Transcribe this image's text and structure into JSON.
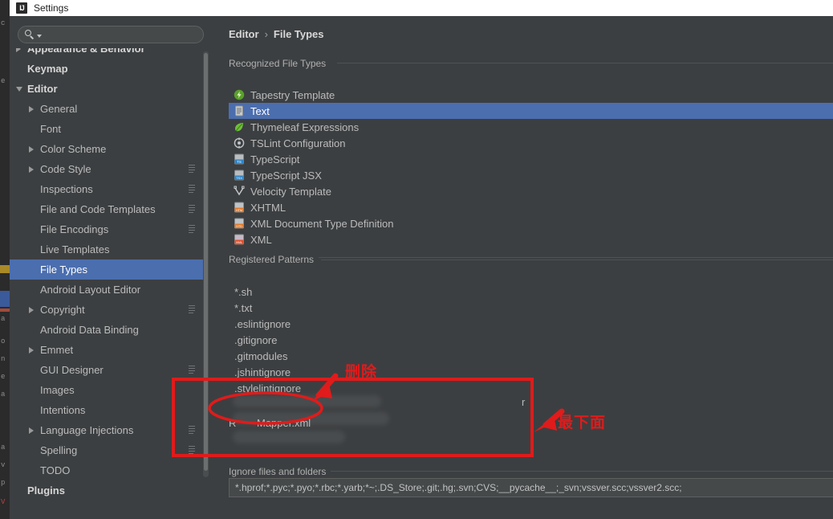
{
  "window": {
    "title": "Settings",
    "logo_icon": "intellij-idea-logo"
  },
  "search": {
    "placeholder": "",
    "value": "",
    "icon": "search-icon",
    "caret_icon": "chevron-down-icon"
  },
  "sidebar": {
    "items": [
      {
        "label": "Appearance & Behavior",
        "level": 0,
        "bold": true,
        "arrow": "right",
        "config_icon": false,
        "selected": false,
        "clipped": true
      },
      {
        "label": "Keymap",
        "level": 0,
        "bold": true,
        "arrow": "none",
        "config_icon": false,
        "selected": false
      },
      {
        "label": "Editor",
        "level": 0,
        "bold": true,
        "arrow": "down",
        "config_icon": false,
        "selected": false
      },
      {
        "label": "General",
        "level": 1,
        "bold": false,
        "arrow": "right",
        "config_icon": false,
        "selected": false
      },
      {
        "label": "Font",
        "level": 1,
        "bold": false,
        "arrow": "none",
        "config_icon": false,
        "selected": false
      },
      {
        "label": "Color Scheme",
        "level": 1,
        "bold": false,
        "arrow": "right",
        "config_icon": false,
        "selected": false
      },
      {
        "label": "Code Style",
        "level": 1,
        "bold": false,
        "arrow": "right",
        "config_icon": true,
        "selected": false
      },
      {
        "label": "Inspections",
        "level": 1,
        "bold": false,
        "arrow": "none",
        "config_icon": true,
        "selected": false
      },
      {
        "label": "File and Code Templates",
        "level": 1,
        "bold": false,
        "arrow": "none",
        "config_icon": true,
        "selected": false
      },
      {
        "label": "File Encodings",
        "level": 1,
        "bold": false,
        "arrow": "none",
        "config_icon": true,
        "selected": false
      },
      {
        "label": "Live Templates",
        "level": 1,
        "bold": false,
        "arrow": "none",
        "config_icon": false,
        "selected": false
      },
      {
        "label": "File Types",
        "level": 1,
        "bold": false,
        "arrow": "none",
        "config_icon": false,
        "selected": true
      },
      {
        "label": "Android Layout Editor",
        "level": 1,
        "bold": false,
        "arrow": "none",
        "config_icon": false,
        "selected": false
      },
      {
        "label": "Copyright",
        "level": 1,
        "bold": false,
        "arrow": "right",
        "config_icon": true,
        "selected": false
      },
      {
        "label": "Android Data Binding",
        "level": 1,
        "bold": false,
        "arrow": "none",
        "config_icon": false,
        "selected": false
      },
      {
        "label": "Emmet",
        "level": 1,
        "bold": false,
        "arrow": "right",
        "config_icon": false,
        "selected": false
      },
      {
        "label": "GUI Designer",
        "level": 1,
        "bold": false,
        "arrow": "none",
        "config_icon": true,
        "selected": false
      },
      {
        "label": "Images",
        "level": 1,
        "bold": false,
        "arrow": "none",
        "config_icon": false,
        "selected": false
      },
      {
        "label": "Intentions",
        "level": 1,
        "bold": false,
        "arrow": "none",
        "config_icon": false,
        "selected": false
      },
      {
        "label": "Language Injections",
        "level": 1,
        "bold": false,
        "arrow": "right",
        "config_icon": true,
        "selected": false
      },
      {
        "label": "Spelling",
        "level": 1,
        "bold": false,
        "arrow": "none",
        "config_icon": true,
        "selected": false
      },
      {
        "label": "TODO",
        "level": 1,
        "bold": false,
        "arrow": "none",
        "config_icon": false,
        "selected": false
      },
      {
        "label": "Plugins",
        "level": 0,
        "bold": true,
        "arrow": "none",
        "config_icon": false,
        "selected": false
      }
    ]
  },
  "breadcrumb": {
    "parent": "Editor",
    "separator": "›",
    "current": "File Types"
  },
  "main": {
    "recognized_label": "Recognized File Types",
    "registered_label": "Registered Patterns",
    "ignore_label": "Ignore files and folders",
    "ignore_value": "*.hprof;*.pyc;*.pyo;*.rbc;*.yarb;*~;.DS_Store;.git;.hg;.svn;CVS;__pycache__;_svn;vssver.scc;vssver2.scc;",
    "file_types": [
      {
        "label": "Tapestry Template",
        "icon": "tapestry-icon",
        "selected": false
      },
      {
        "label": "Text",
        "icon": "text-file-icon",
        "selected": true
      },
      {
        "label": "Thymeleaf Expressions",
        "icon": "thymeleaf-icon",
        "selected": false
      },
      {
        "label": "TSLint Configuration",
        "icon": "tslint-icon",
        "selected": false
      },
      {
        "label": "TypeScript",
        "icon": "typescript-icon",
        "selected": false
      },
      {
        "label": "TypeScript JSX",
        "icon": "typescript-jsx-icon",
        "selected": false
      },
      {
        "label": "Velocity Template",
        "icon": "velocity-icon",
        "selected": false
      },
      {
        "label": "XHTML",
        "icon": "xhtml-icon",
        "selected": false
      },
      {
        "label": "XML Document Type Definition",
        "icon": "dtd-icon",
        "selected": false
      },
      {
        "label": "XML",
        "icon": "xml-icon",
        "selected": false
      }
    ],
    "patterns": [
      "*.sh",
      "*.txt",
      ".eslintignore",
      ".gitignore",
      ".gitmodules",
      ".jshintignore",
      ".stylelintignore"
    ],
    "pattern_partial_right": "r",
    "pattern_mapper_prefix": "R",
    "pattern_mapper": "Mapper.xml"
  },
  "annotations": {
    "delete_note": "删除",
    "bottom_note": "最下面",
    "color": "#e01b1b"
  },
  "background_strip": {
    "lines": [
      "c",
      "e",
      "a",
      "o",
      "n",
      "e",
      "a",
      "v",
      "p",
      "V"
    ]
  }
}
